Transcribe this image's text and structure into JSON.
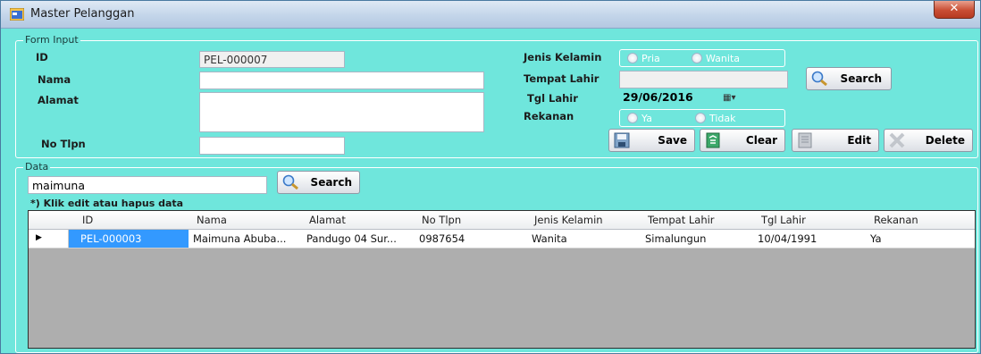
{
  "window": {
    "title": "Master Pelanggan",
    "close_glyph": "✕"
  },
  "form_input": {
    "legend": "Form Input",
    "labels": {
      "id": "ID",
      "nama": "Nama",
      "alamat": "Alamat",
      "no_tlpn": "No Tlpn",
      "jenis_kelamin": "Jenis Kelamin",
      "tempat_lahir": "Tempat Lahir",
      "tgl_lahir": "Tgl Lahir",
      "rekanan": "Rekanan"
    },
    "values": {
      "id": "PEL-000007",
      "nama": "",
      "alamat": "",
      "no_tlpn": "",
      "tempat_lahir": "",
      "tgl_lahir": "29/06/2016"
    },
    "gender_options": [
      "Pria",
      "Wanita"
    ],
    "rekanan_options": [
      "Ya",
      "Tidak"
    ],
    "search_label": "Search",
    "buttons": {
      "save": "Save",
      "clear": "Clear",
      "edit": "Edit",
      "delete": "Delete"
    }
  },
  "data_section": {
    "legend": "Data",
    "search_value": "maimuna",
    "search_label": "Search",
    "hint": "*) Klik edit atau hapus data"
  },
  "grid": {
    "columns": [
      "ID",
      "Nama",
      "Alamat",
      "No Tlpn",
      "Jenis Kelamin",
      "Tempat Lahir",
      "Tgl Lahir",
      "Rekanan"
    ],
    "rows": [
      [
        "PEL-000003",
        "Maimuna Abuba...",
        "Pandugo 04 Sur...",
        "0987654",
        "Wanita",
        "Simalungun",
        "10/04/1991",
        "Ya"
      ]
    ]
  },
  "colors": {
    "background": "#6fe6dc",
    "selection": "#3399ff"
  }
}
